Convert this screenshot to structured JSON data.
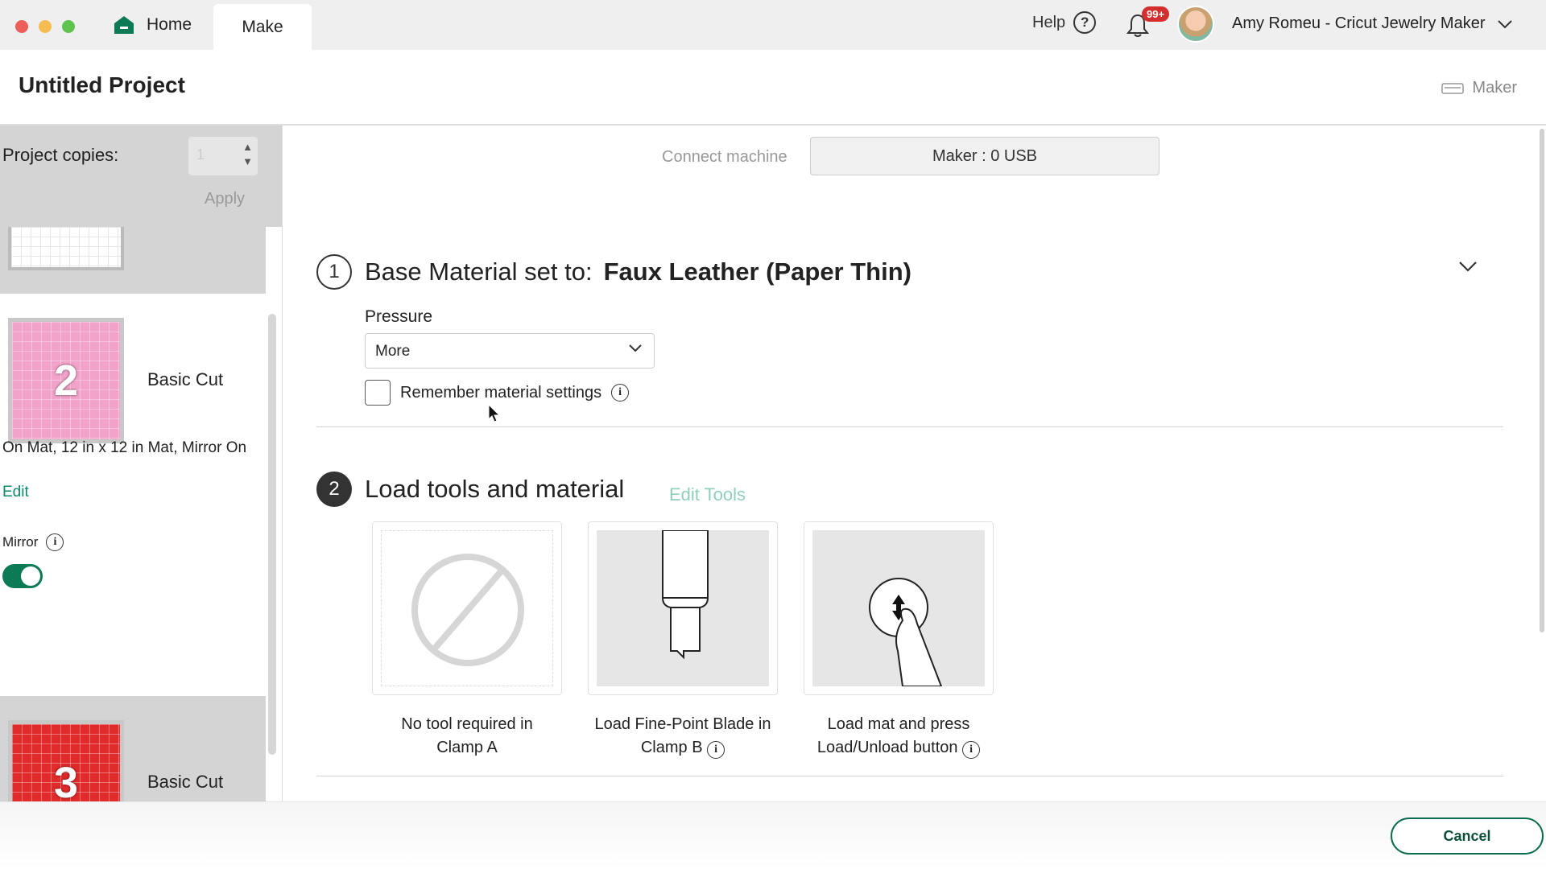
{
  "topbar": {
    "home_label": "Home",
    "make_label": "Make",
    "help_label": "Help",
    "notification_badge": "99+",
    "user_label": "Amy Romeu - Cricut Jewelry Maker"
  },
  "project": {
    "title": "Untitled Project",
    "machine_label": "Maker"
  },
  "left_panel": {
    "copies_label": "Project copies:",
    "copies_value": "1",
    "apply_label": "Apply",
    "mats": [
      {
        "number": "2",
        "name": "Basic Cut",
        "color": "#f3a3c9"
      },
      {
        "number": "3",
        "name": "Basic Cut",
        "color": "#e12a2a"
      }
    ],
    "mat_info": "On Mat, 12 in x 12 in Mat, Mirror On",
    "edit_label": "Edit",
    "mirror_label": "Mirror",
    "mirror_on": true
  },
  "main": {
    "connect_label": "Connect machine",
    "connect_value": "Maker : 0 USB",
    "step1": {
      "number": "1",
      "prefix": "Base Material set to:",
      "material": "Faux Leather (Paper Thin)",
      "pressure_label": "Pressure",
      "pressure_value": "More",
      "remember_label": "Remember material settings"
    },
    "step2": {
      "number": "2",
      "title": "Load tools and material",
      "edit_tools_label": "Edit Tools",
      "cards": [
        {
          "line1": "No tool required in",
          "line2": "Clamp A"
        },
        {
          "line1": "Load Fine-Point Blade in",
          "line2": "Clamp B"
        },
        {
          "line1": "Load mat and press",
          "line2": "Load/Unload button"
        }
      ]
    }
  },
  "footer": {
    "cancel_label": "Cancel"
  },
  "colors": {
    "accent": "#0b7a55",
    "edit_tools": "#8fd0bb"
  }
}
